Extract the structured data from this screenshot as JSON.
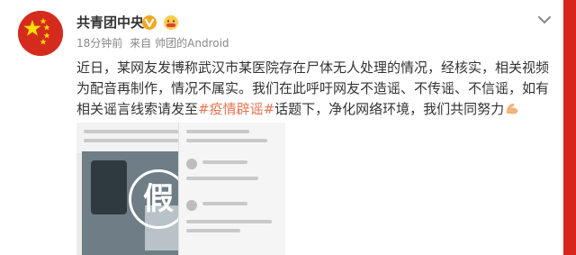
{
  "post": {
    "username": "共青团中央",
    "meta": {
      "time": "18分钟前",
      "source_prefix": "来自",
      "source": "帅团的Android"
    },
    "text_before_tag": "近日，某网友发博称武汉市某医院存在尸体无人处理的情况，经核实，相关视频为配音再制作，情况不属实。我们在此呼吁网友不造谣、不传谣、不信谣，如有相关谣言线索请发至",
    "hashtag": "#疫情辟谣#",
    "text_after_tag": "话题下，净化网络环境，我们共同努力",
    "attached_image": {
      "stamp": "假"
    }
  },
  "icons": {
    "verified": "verified-badge-icon",
    "reaction": "reaction-emoji-icon",
    "dropdown": "chevron-down-icon",
    "flex": "flexed-biceps-emoji-icon"
  },
  "colors": {
    "hashtag": "#eb7350",
    "verified": "#f5a623",
    "strip": "#d9261c"
  }
}
